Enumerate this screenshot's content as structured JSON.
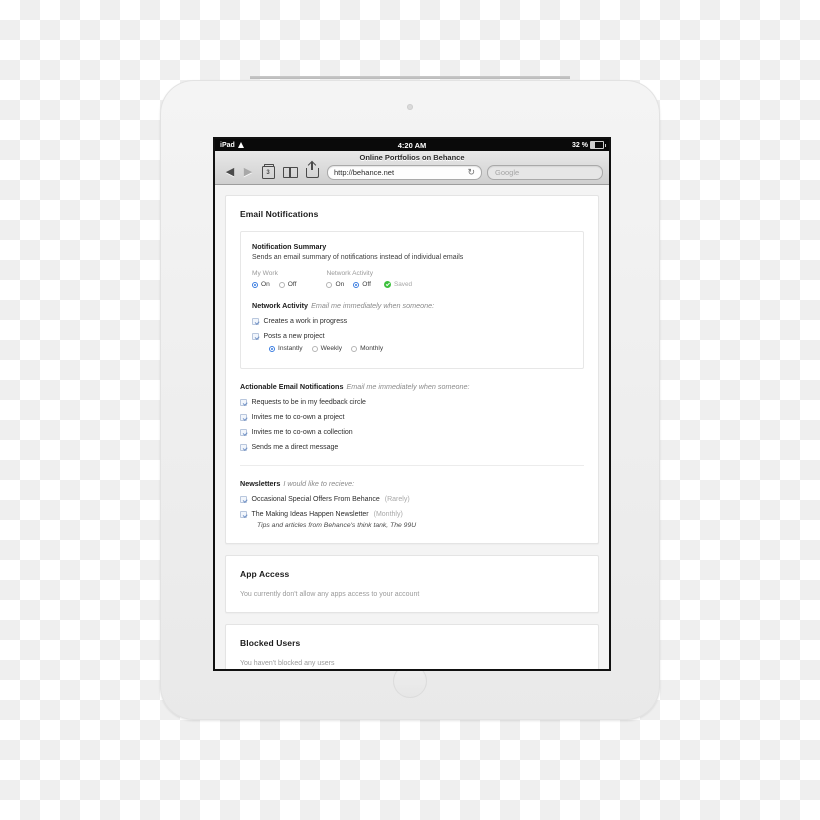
{
  "device": {
    "name": "ipad-white",
    "camera": "camera-dot",
    "home_button": "home-button"
  },
  "status_bar": {
    "carrier": "iPad",
    "wifi_icon": "wifi-icon",
    "time": "4:20 AM",
    "battery_text": "32 %",
    "battery_icon": "battery-icon",
    "battery_level": 32
  },
  "browser": {
    "page_title": "Online Portfolios on Behance",
    "back_icon": "back-arrow-icon",
    "forward_icon": "forward-arrow-icon",
    "tabs_icon": "tabs-icon",
    "tabs_count": "3",
    "bookmarks_icon": "book-icon",
    "share_icon": "share-icon",
    "url": "http://behance.net",
    "reload_icon": "reload-icon",
    "search_placeholder": "Google"
  },
  "email_card": {
    "title": "Email Notifications",
    "summary_panel": {
      "heading": "Notification Summary",
      "description": "Sends an email summary of notifications instead of individual emails",
      "groups": [
        {
          "label": "My Work",
          "options": [
            {
              "label": "On",
              "selected": true
            },
            {
              "label": "Off",
              "selected": false
            }
          ],
          "saved": null
        },
        {
          "label": "Network Activity",
          "options": [
            {
              "label": "On",
              "selected": false
            },
            {
              "label": "Off",
              "selected": true
            }
          ],
          "saved": "Saved"
        }
      ]
    },
    "network_activity": {
      "heading": "Network Activity",
      "hint": "Email me immediately when someone:",
      "items": [
        {
          "label": "Creates a work in progress",
          "checked": true
        },
        {
          "label": "Posts a new project",
          "checked": true
        }
      ],
      "frequency": [
        {
          "label": "Instantly",
          "selected": true
        },
        {
          "label": "Weekly",
          "selected": false
        },
        {
          "label": "Monthly",
          "selected": false
        }
      ]
    },
    "actionable": {
      "heading": "Actionable Email Notifications",
      "hint": "Email me immediately when someone:",
      "items": [
        {
          "label": "Requests to be in my feedback circle",
          "checked": true
        },
        {
          "label": "Invites me to co-own a project",
          "checked": true
        },
        {
          "label": "Invites me to co-own a collection",
          "checked": true
        },
        {
          "label": "Sends me a direct message",
          "checked": true
        }
      ]
    },
    "newsletters": {
      "heading": "Newsletters",
      "hint": "I would like to recieve:",
      "items": [
        {
          "label": "Occasional Special Offers From Behance",
          "frequency": "(Rarely)",
          "checked": true
        },
        {
          "label": "The Making Ideas Happen Newsletter",
          "frequency": "(Monthly)",
          "checked": true
        }
      ],
      "note": "Tips and articles from Behance's think tank, The 99U"
    }
  },
  "app_access_card": {
    "title": "App Access",
    "message": "You currently don't allow any apps access to your account"
  },
  "blocked_users_card": {
    "title": "Blocked Users",
    "message": "You haven't blocked any users"
  }
}
